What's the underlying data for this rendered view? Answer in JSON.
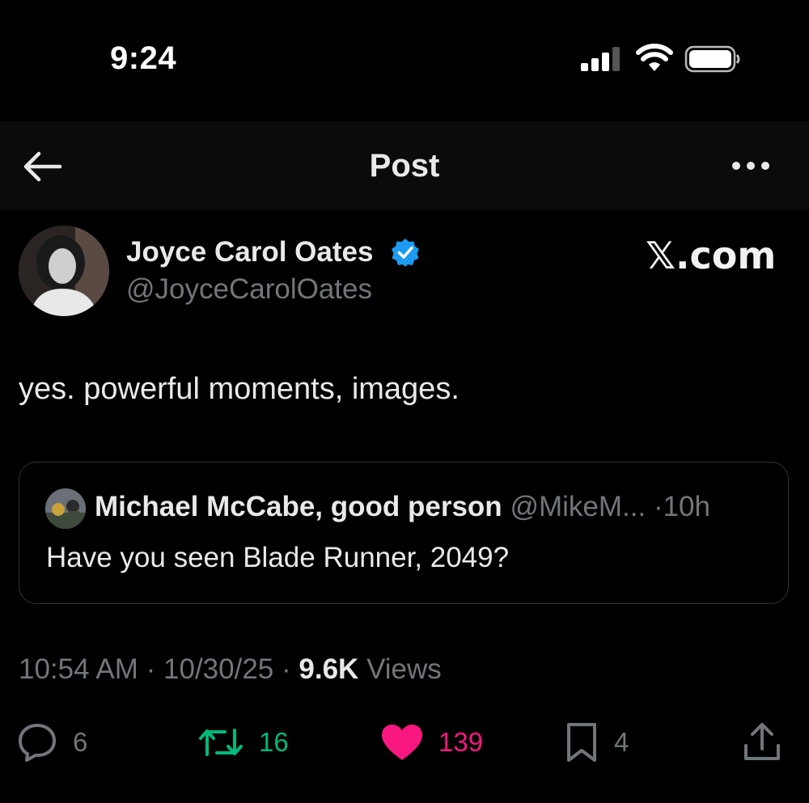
{
  "status_bar": {
    "time": "9:24"
  },
  "header": {
    "title": "Post"
  },
  "author": {
    "name": "Joyce Carol Oates",
    "handle": "@JoyceCarolOates",
    "verified": true
  },
  "watermark": "𝕏.com",
  "post": {
    "text": "yes. powerful moments, images."
  },
  "quote": {
    "name": "Michael McCabe, good person",
    "handle": "@MikeM...",
    "separator": "·",
    "time": "10h",
    "text": "Have you seen Blade Runner, 2049?"
  },
  "meta": {
    "time": "10:54 AM",
    "date": "10/30/25",
    "sep": "·",
    "views_count": "9.6K",
    "views_label": "Views"
  },
  "actions": {
    "replies": "6",
    "reposts": "16",
    "likes": "139",
    "bookmarks": "4"
  },
  "colors": {
    "background": "#000000",
    "text": "#e7e9ea",
    "secondary": "#71767b",
    "verified": "#1d9bf0",
    "repost": "#00ba7c",
    "like": "#f91880",
    "border": "#2f3336"
  },
  "icons": [
    "back-arrow-icon",
    "more-icon",
    "verified-badge-icon",
    "reply-icon",
    "repost-icon",
    "heart-icon",
    "bookmark-icon",
    "share-icon"
  ]
}
